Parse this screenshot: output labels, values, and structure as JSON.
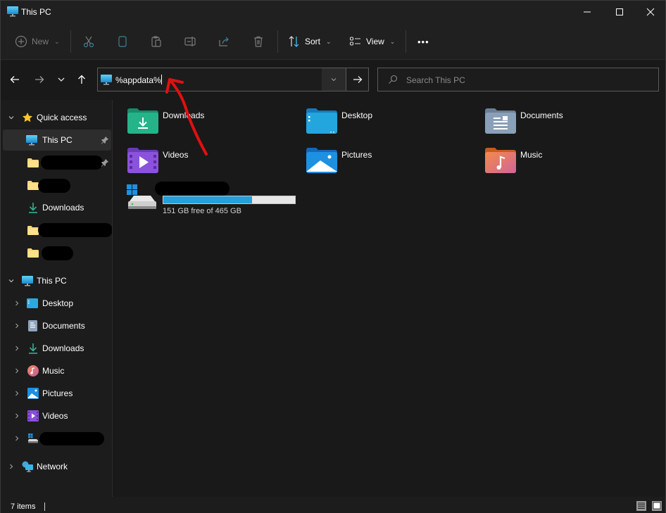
{
  "window": {
    "title": "This PC",
    "controls": [
      "minimize",
      "maximize",
      "close"
    ]
  },
  "commandbar": {
    "new_label": "New",
    "sort_label": "Sort",
    "view_label": "View",
    "more_label": "•••",
    "icons": [
      "new-icon",
      "cut-icon",
      "copy-icon",
      "paste-icon",
      "rename-icon",
      "share-icon",
      "delete-icon",
      "sort-icon",
      "view-icon",
      "more-icon"
    ]
  },
  "navigation": {
    "address_value": "%appdata%",
    "search_placeholder": "Search This PC"
  },
  "sidebar": {
    "quick_access": {
      "label": "Quick access",
      "items": [
        {
          "label": "This PC",
          "icon": "pc-icon",
          "pinned": true,
          "selected": true
        },
        {
          "label": "",
          "icon": "folder-icon",
          "pinned": true,
          "redacted": true
        },
        {
          "label": "",
          "icon": "folder-icon",
          "redacted": true
        },
        {
          "label": "Downloads",
          "icon": "download-icon"
        },
        {
          "label": "",
          "icon": "folder-icon",
          "redacted": true
        },
        {
          "label": "",
          "icon": "folder-icon",
          "redacted": true
        }
      ]
    },
    "this_pc": {
      "label": "This PC",
      "items": [
        {
          "label": "Desktop",
          "icon": "desktop-icon"
        },
        {
          "label": "Documents",
          "icon": "documents-icon"
        },
        {
          "label": "Downloads",
          "icon": "download-icon"
        },
        {
          "label": "Music",
          "icon": "music-icon"
        },
        {
          "label": "Pictures",
          "icon": "pictures-icon"
        },
        {
          "label": "Videos",
          "icon": "videos-icon"
        },
        {
          "label": "",
          "icon": "drive-icon",
          "redacted": true
        }
      ]
    },
    "network": {
      "label": "Network"
    }
  },
  "content": {
    "folders": [
      {
        "label": "Downloads",
        "icon": "downloads-folder-icon"
      },
      {
        "label": "Desktop",
        "icon": "desktop-folder-icon"
      },
      {
        "label": "Documents",
        "icon": "documents-folder-icon"
      },
      {
        "label": "Videos",
        "icon": "videos-folder-icon"
      },
      {
        "label": "Pictures",
        "icon": "pictures-folder-icon"
      },
      {
        "label": "Music",
        "icon": "music-folder-icon"
      }
    ],
    "drive": {
      "name": "",
      "redacted": true,
      "free_text": "151 GB free of 465 GB",
      "free_gb": 151,
      "total_gb": 465,
      "used_fraction": 0.675
    }
  },
  "statusbar": {
    "items_text": "7 items",
    "view_modes": [
      "details-view",
      "tiles-view"
    ]
  },
  "colors": {
    "accent": "#26a0da",
    "annotation": "#e01010",
    "background": "#191919"
  }
}
